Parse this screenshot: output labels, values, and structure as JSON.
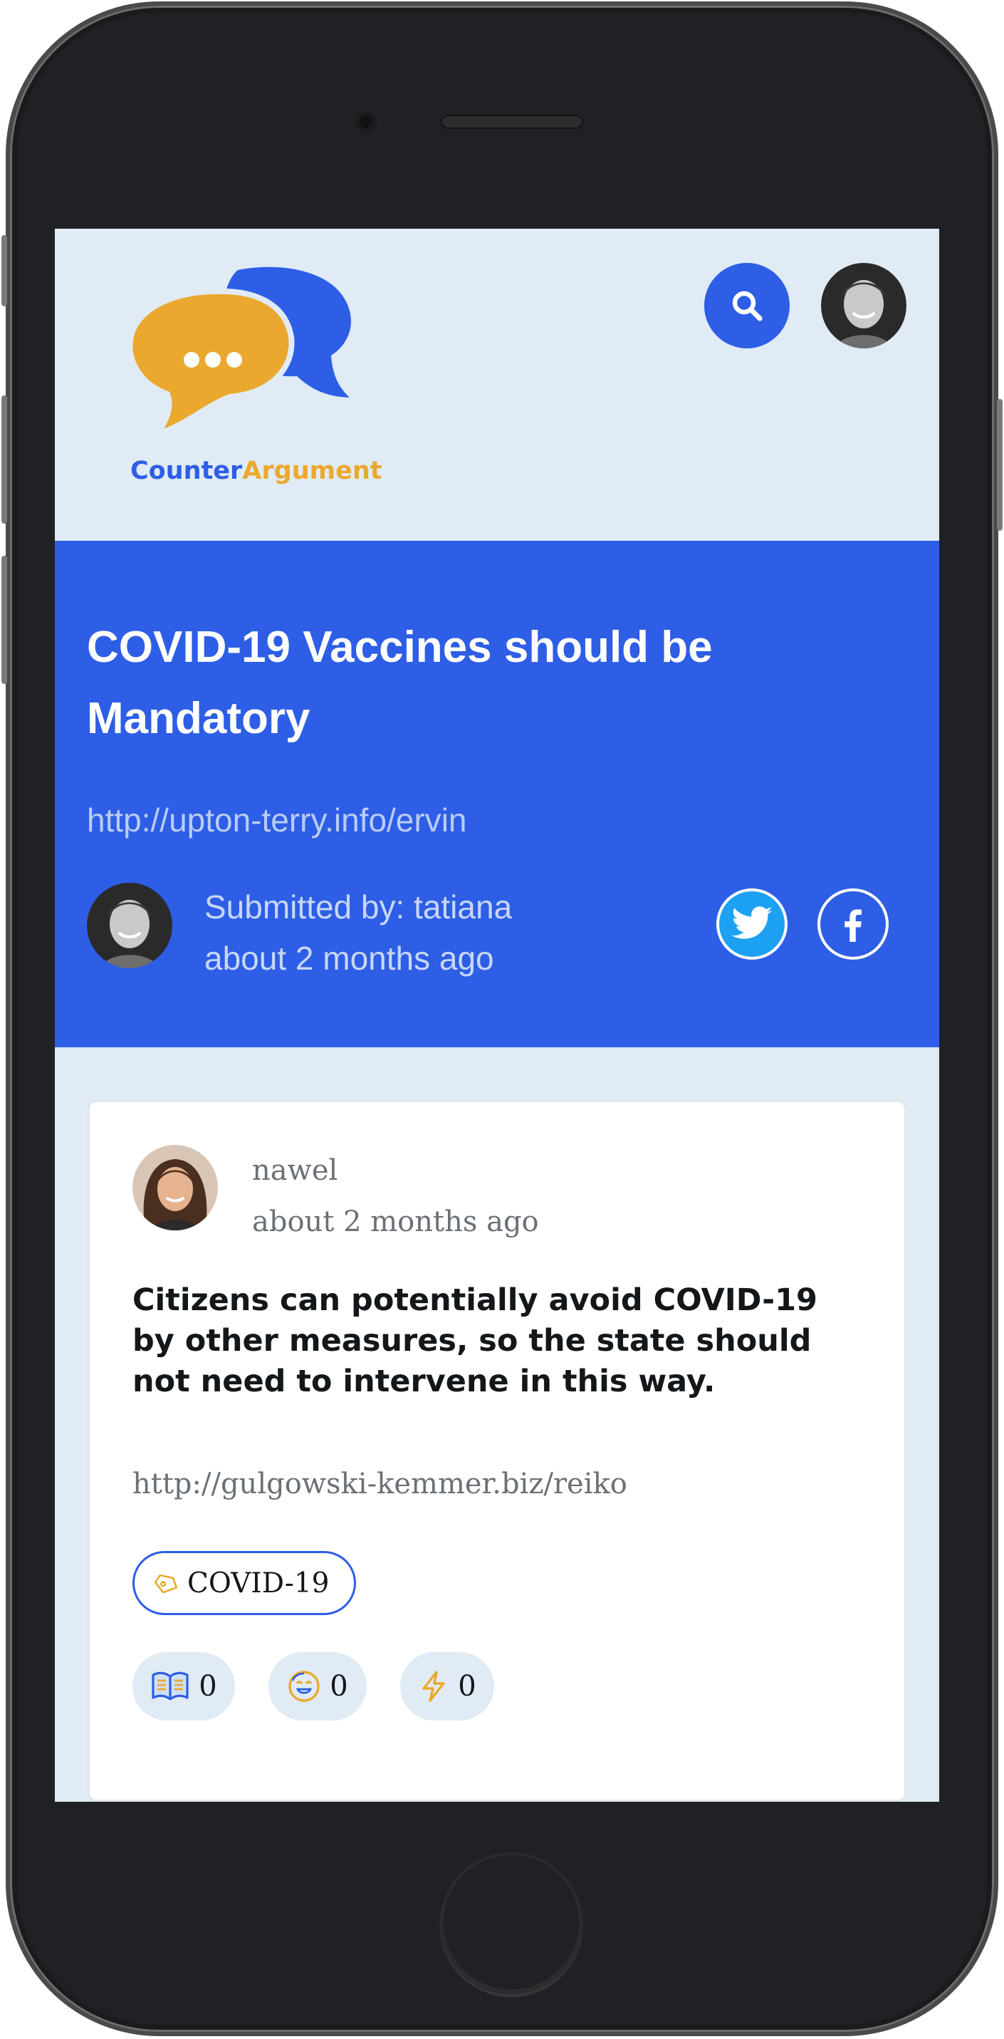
{
  "header": {
    "logo_counter": "Counter",
    "logo_argument": "Argument",
    "search_icon": "search-icon",
    "brand_blue": "#2d5ee5",
    "brand_orange": "#eaa92e"
  },
  "hero": {
    "title": "COVID-19 Vaccines should be Mandatory",
    "link": "http://upton-terry.info/ervin",
    "submitted_by": "Submitted by: tatiana",
    "time": "about 2 months ago",
    "share_icons": [
      "twitter-icon",
      "facebook-icon"
    ]
  },
  "argument": {
    "author": "nawel",
    "time": "about 2 months ago",
    "claim": "Citizens can potentially avoid COVID-19 by other measures, so the state should not need to intervene in this way.",
    "link": "http://gulgowski-kemmer.biz/reiko",
    "tag": "COVID-19",
    "reactions": [
      {
        "icon": "book-icon",
        "count": "0"
      },
      {
        "icon": "smile-icon",
        "count": "0"
      },
      {
        "icon": "lightning-icon",
        "count": "0"
      }
    ]
  }
}
